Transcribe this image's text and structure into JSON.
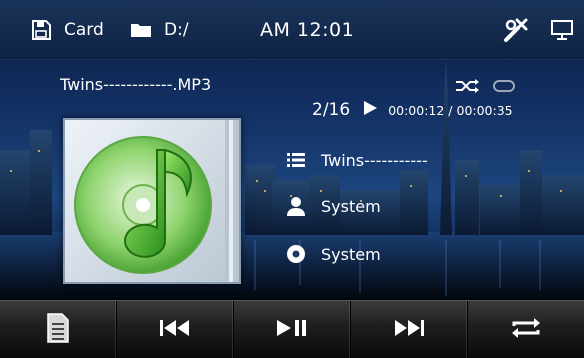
{
  "status_bar": {
    "source_label": "Card",
    "folder_label": "D:/",
    "clock": "AM 12:01"
  },
  "now_playing": {
    "filename": "Twins------------.MP3",
    "track_index": "2/16",
    "time": "00:00:12 / 00:00:35",
    "title": "Twins-----------",
    "artist": "System",
    "album": "System"
  },
  "icons": {
    "sd_card": "sd-card-icon",
    "folder": "folder-icon",
    "settings": "tools-icon",
    "display": "monitor-icon",
    "shuffle": "shuffle-icon",
    "repeat": "repeat-icon",
    "play_state": "play-icon",
    "title": "list-icon",
    "artist": "person-icon",
    "album": "disc-icon"
  },
  "toolbar": [
    "playlist",
    "previous",
    "play-pause",
    "next",
    "repeat"
  ],
  "colors": {
    "accent_green": "#3fbf2a",
    "text": "#ffffff"
  }
}
